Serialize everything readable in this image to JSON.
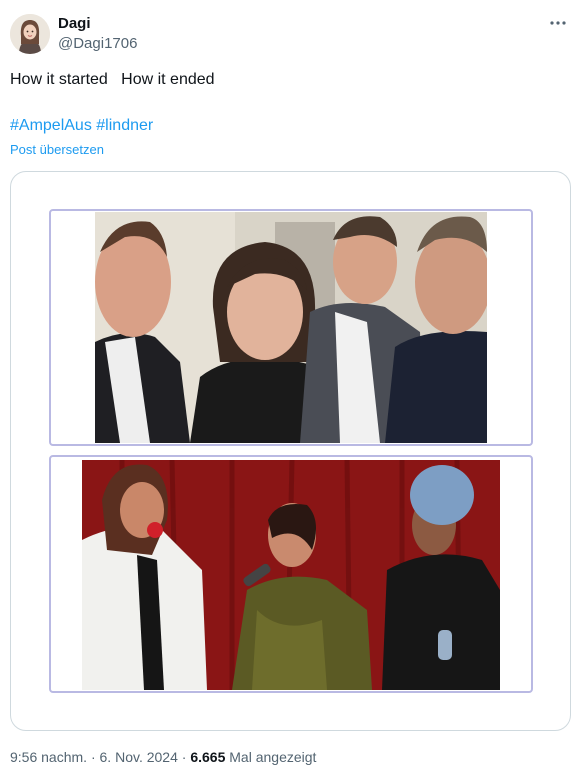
{
  "author": {
    "display_name": "Dagi",
    "handle": "@Dagi1706",
    "avatar_icon": "avatar-illustration-icon"
  },
  "more_icon": "more-horizontal-icon",
  "tweet": {
    "text": "How it started   How it ended",
    "hashtags": [
      "#AmpelAus",
      "#lindner"
    ],
    "translate_label": "Post übersetzen"
  },
  "media": {
    "top_image": "group-selfie-photo",
    "bottom_image": "stage-singers-photo"
  },
  "meta": {
    "time": "9:56 nachm.",
    "separator": "·",
    "date": "6. Nov. 2024",
    "views": "6.665",
    "views_label": "Mal angezeigt"
  },
  "colors": {
    "accent": "#1d9bf0",
    "text": "#0f1419",
    "muted": "#536471",
    "frame_border": "#b9b9e3"
  }
}
